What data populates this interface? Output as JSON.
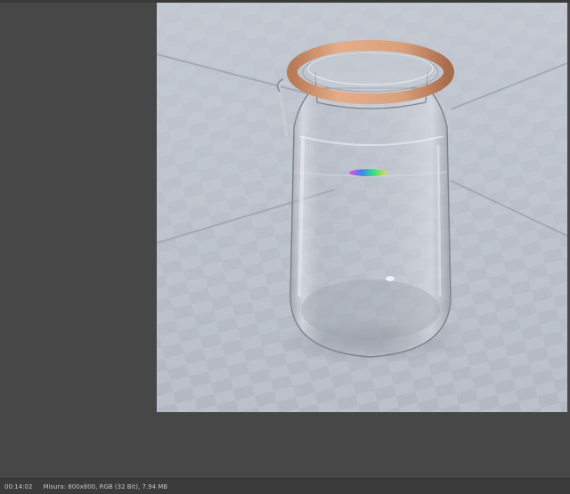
{
  "viewer": {
    "background_color": "#474747",
    "canvas_background": "#b9bec8"
  },
  "render": {
    "subject": "glass-jar-icon",
    "lid_seal_color": "#d9a07c"
  },
  "status_bar": {
    "render_time": "00:14:02",
    "image_info": "Misura: 800x800, RGB (32 Bit), 7.94 MB"
  }
}
